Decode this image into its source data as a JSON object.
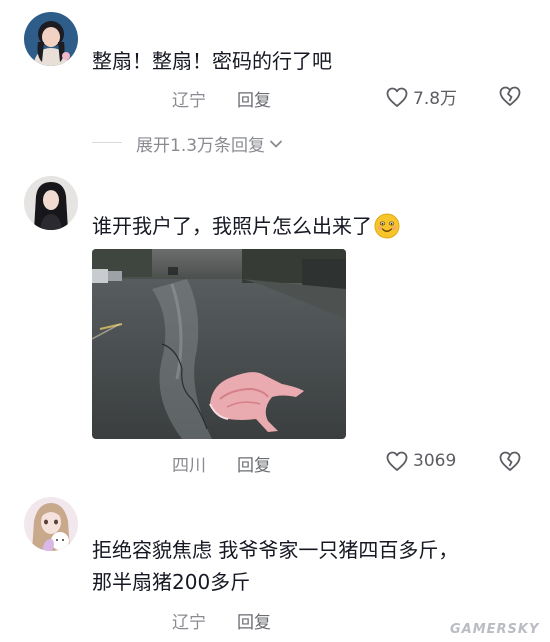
{
  "comments": [
    {
      "text": "整扇！整扇！密码的行了吧",
      "location": "辽宁",
      "reply_label": "回复",
      "likes": "7.8万",
      "expand_label": "展开1.3万条回复"
    },
    {
      "text": "谁开我户了，我照片怎么出来了",
      "emoji": "smile-emoji",
      "location": "四川",
      "reply_label": "回复",
      "likes": "3069"
    },
    {
      "text_line1": "拒绝容貌焦虑 我爷爷家一只猪四百多斤，",
      "text_line2": "那半扇猪200多斤",
      "location": "辽宁",
      "reply_label": "回复"
    }
  ],
  "watermark": "GAMERSKY",
  "colors": {
    "text": "#161823",
    "meta": "#8a8b91",
    "emoji": "#f7c52b"
  },
  "icons": [
    "heart-outline-icon",
    "broken-heart-icon",
    "chevron-down-icon"
  ]
}
